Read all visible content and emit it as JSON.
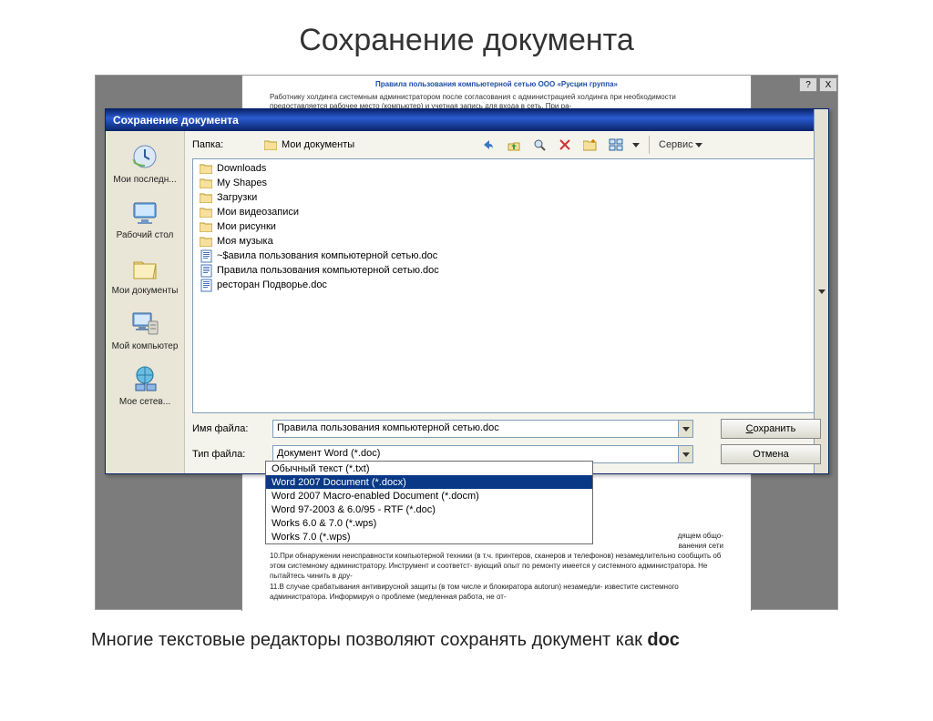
{
  "slide": {
    "title": "Сохранение документа",
    "caption_pre": "Многие текстовые редакторы позволяют сохранять документ как ",
    "caption_bold": "doc"
  },
  "bgdoc": {
    "title_partial": "Правила пользования компьютерной сетью ООО «Русцин группа»",
    "para": "Работнику холдинга системным администратором после согласования с администрацией холдинга при необходимости предоставляется рабочее место (компьютер) и учетная запись для входа в сеть. При ра-",
    "lower_lines": [
      "дящем общо-",
      "ванения сети",
      "10.При обнаружении неисправности компьютерной техники (в т.ч. принтеров, сканеров и телефонов) незамедлительно сообщить об этом системному администратору. Инструмент и соответст- вующий опыт по ремонту имеется у системного администратора. Не пытайтесь чинить в дру-",
      "11.В случае срабатывания антивирусной защиты (в том числе и блокиратора autorun) незамедли- известите системного администратора. Информируя о проблеме (медленная работа, не от-"
    ]
  },
  "dialog": {
    "title": "Сохранение документа",
    "folder_label": "Папка:",
    "current_folder": "Мои документы",
    "service_label": "Сервис",
    "places": [
      {
        "label": "Мои последн...",
        "icon": "recent"
      },
      {
        "label": "Рабочий стол",
        "icon": "desktop"
      },
      {
        "label": "Мои документы",
        "icon": "mydocs"
      },
      {
        "label": "Мой компьютер",
        "icon": "mycomp"
      },
      {
        "label": "Мое сетев...",
        "icon": "network"
      }
    ],
    "files": [
      {
        "name": "Downloads",
        "type": "folder"
      },
      {
        "name": "My Shapes",
        "type": "folder"
      },
      {
        "name": "Загрузки",
        "type": "folder"
      },
      {
        "name": "Мои видеозаписи",
        "type": "folder"
      },
      {
        "name": "Мои рисунки",
        "type": "folder"
      },
      {
        "name": "Моя музыка",
        "type": "folder"
      },
      {
        "name": "~$авила пользования компьютерной сетью.doc",
        "type": "doc"
      },
      {
        "name": "Правила пользования компьютерной сетью.doc",
        "type": "doc"
      },
      {
        "name": "ресторан Подворье.doc",
        "type": "doc"
      }
    ],
    "filename_label": "Имя файла:",
    "filename_value": "Правила пользования компьютерной сетью.doc",
    "filetype_label": "Тип файла:",
    "filetype_value": "Документ Word (*.doc)",
    "save_label": "Сохранить",
    "cancel_label": "Отмена",
    "type_options": [
      {
        "text": "Обычный текст (*.txt)",
        "sel": false
      },
      {
        "text": "Word 2007 Document (*.docx)",
        "sel": true
      },
      {
        "text": "Word 2007 Macro-enabled Document (*.docm)",
        "sel": false
      },
      {
        "text": "Word 97-2003 & 6.0/95 - RTF (*.doc)",
        "sel": false
      },
      {
        "text": "Works 6.0 & 7.0 (*.wps)",
        "sel": false
      },
      {
        "text": "Works 7.0 (*.wps)",
        "sel": false
      }
    ]
  },
  "topright": {
    "help": "?",
    "close": "X"
  }
}
